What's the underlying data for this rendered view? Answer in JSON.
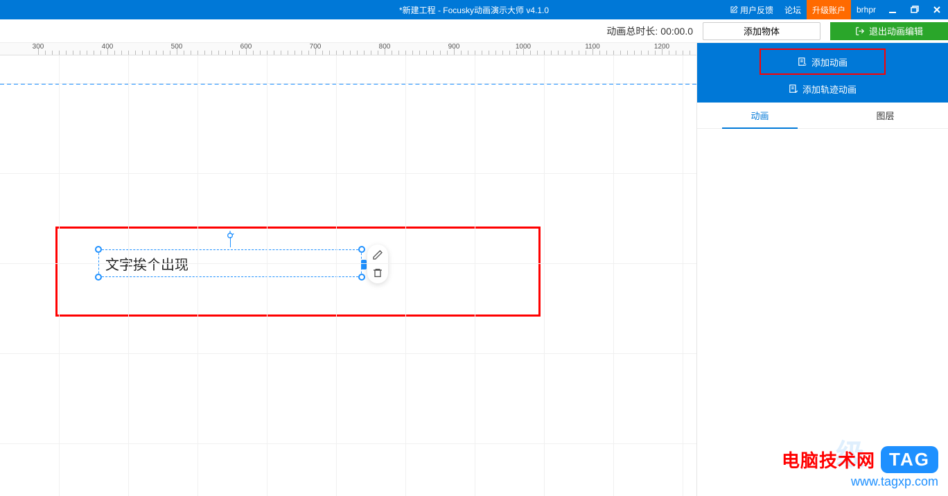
{
  "title_bar": {
    "title": "*新建工程 - Focusky动画演示大师  v4.1.0",
    "feedback": "用户反馈",
    "forum": "论坛",
    "upgrade": "升级账户",
    "user": "brhpr"
  },
  "sec_bar": {
    "duration_label": "动画总时长:",
    "duration_value": "00:00.0",
    "add_object": "添加物体",
    "exit_edit": "退出动画编辑"
  },
  "ruler": {
    "ticks": [
      300,
      400,
      500,
      600,
      700,
      800,
      900,
      1000,
      1100,
      1200
    ]
  },
  "canvas": {
    "text_content": "文字挨个出现"
  },
  "right_panel": {
    "add_animation": "添加动画",
    "add_track_animation": "添加轨迹动画",
    "tabs": {
      "animation": "动画",
      "layer": "图层"
    }
  },
  "watermark": {
    "brand": "电脑技术网",
    "tag": "TAG",
    "url": "www.tagxp.com"
  }
}
